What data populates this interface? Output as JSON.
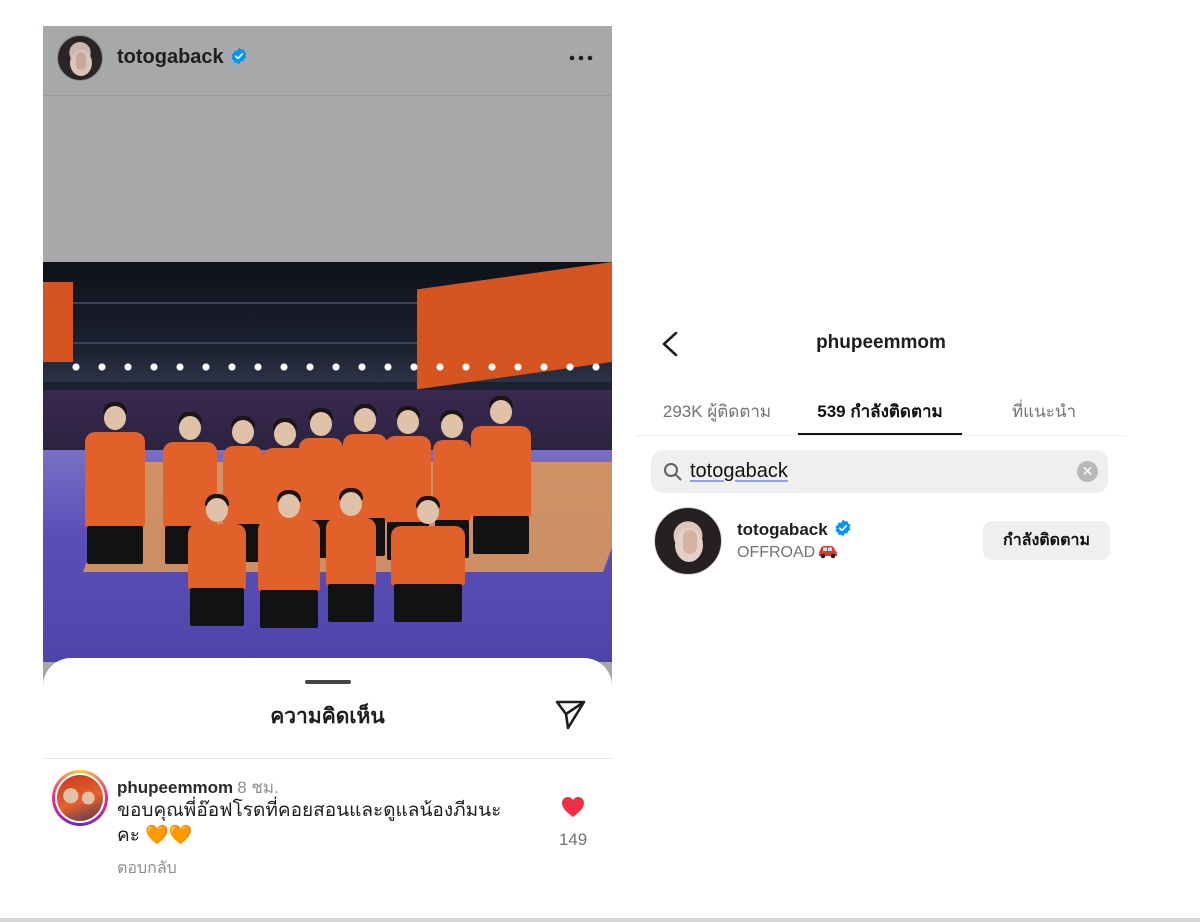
{
  "post": {
    "username": "totogaback",
    "more_icon": "more-horizontal-icon"
  },
  "comments_sheet": {
    "title": "ความคิดเห็น",
    "comment": {
      "username": "phupeemmom",
      "time": "8 ชม.",
      "text": "ขอบคุณพี่อ๊อฟโรดที่คอยสอนและดูแลน้องภีมนะคะ 🧡🧡",
      "reply_label": "ตอบกลับ",
      "like_count": "149"
    }
  },
  "profile_following": {
    "title": "phupeemmom",
    "tabs": [
      {
        "label": "293K ผู้ติดตาม"
      },
      {
        "label": "539 กำลังติดตาม"
      },
      {
        "label": "ที่แนะนำ"
      }
    ],
    "active_tab": 1,
    "search": {
      "value": "totogaback"
    },
    "result": {
      "username": "totogaback",
      "bio": "OFFROAD",
      "follow_button": "กำลังติดตาม"
    }
  },
  "colors": {
    "verified": "#0095f6",
    "like_heart": "#ed2f46",
    "jersey": "#e2602a"
  }
}
